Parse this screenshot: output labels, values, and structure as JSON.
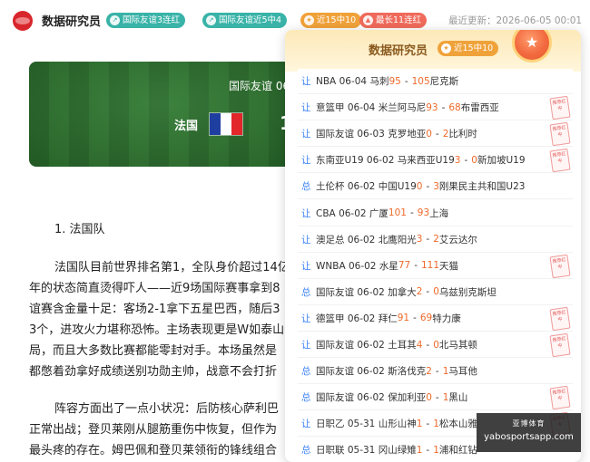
{
  "header": {
    "brand": "数据研究员",
    "pills": [
      {
        "label": "国际友谊3连红",
        "icon": "trend-icon",
        "color": "#39b3a8"
      },
      {
        "label": "国际友谊近5中4",
        "icon": "trend-icon",
        "color": "#39b3a8"
      },
      {
        "label": "近15中10",
        "icon": "star-icon",
        "color": "#f0a23a"
      },
      {
        "label": "最长11连红",
        "icon": "flame-icon",
        "color": "#ef6a5b"
      }
    ],
    "updated": "最近更新：2026-06-05 00:01"
  },
  "banner": {
    "title": "国际友谊 06",
    "team": "法国",
    "score_peek": "1"
  },
  "article": {
    "heading": "1. 法国队",
    "lines": [
      "法国队目前世界排名第1，全队身价超过14亿",
      "年的状态简直烫得吓人——近9场国际赛事拿到8",
      "谊赛含金量十足：客场2-1拿下五星巴西，随后3",
      "3个，进攻火力堪称恐怖。主场表现更是W如泰山",
      "局，而且大多数比赛都能零封对手。本场虽然是",
      "都憋着劲拿好成绩送别功勋主帅，战意不会打折",
      "阵容方面出了一点小状况：后防核心萨利巴",
      "正常出战；登贝莱刚从腿筋重伤中恢复，但作为",
      "最头疼的存在。姆巴佩和登贝莱领衔的锋线组合"
    ]
  },
  "panel": {
    "title": "数据研究员",
    "tag": "近15中10",
    "stamp_text": "推荐红中",
    "rows": [
      {
        "type": "让",
        "league": "NBA",
        "date": "06-04",
        "home": "马刺",
        "s1": "95",
        "s2": "105",
        "away": "尼克斯",
        "stamp": false
      },
      {
        "type": "让",
        "league": "意篮甲",
        "date": "06-04",
        "home": "米兰阿马尼",
        "s1": "93",
        "s2": "68",
        "away": "布雷西亚",
        "stamp": true
      },
      {
        "type": "让",
        "league": "国际友谊",
        "date": "06-03",
        "home": "克罗地亚",
        "s1": "0",
        "s2": "2",
        "away": "比利时",
        "stamp": true
      },
      {
        "type": "让",
        "league": "东南亚U19",
        "date": "06-02",
        "home": "马来西亚U19",
        "s1": "3",
        "s2": "0",
        "away": "新加坡U19",
        "stamp": true
      },
      {
        "type": "总",
        "league": "土伦杯",
        "date": "06-02",
        "home": "中国U19",
        "s1": "0",
        "s2": "3",
        "away": "刚果民主共和国U23",
        "stamp": false
      },
      {
        "type": "让",
        "league": "CBA",
        "date": "06-02",
        "home": "广厦",
        "s1": "101",
        "s2": "93",
        "away": "上海",
        "stamp": false
      },
      {
        "type": "让",
        "league": "澳足总",
        "date": "06-02",
        "home": "北鹰阳光",
        "s1": "3",
        "s2": "2",
        "away": "艾云达尔",
        "stamp": false
      },
      {
        "type": "让",
        "league": "WNBA",
        "date": "06-02",
        "home": "水星",
        "s1": "77",
        "s2": "111",
        "away": "天猫",
        "stamp": true
      },
      {
        "type": "总",
        "league": "国际友谊",
        "date": "06-02",
        "home": "加拿大",
        "s1": "2",
        "s2": "0",
        "away": "乌兹别克斯坦",
        "stamp": false
      },
      {
        "type": "让",
        "league": "德篮甲",
        "date": "06-02",
        "home": "拜仁",
        "s1": "91",
        "s2": "69",
        "away": "特力康",
        "stamp": true
      },
      {
        "type": "让",
        "league": "国际友谊",
        "date": "06-02",
        "home": "土耳其",
        "s1": "4",
        "s2": "0",
        "away": "北马其顿",
        "stamp": true
      },
      {
        "type": "总",
        "league": "国际友谊",
        "date": "06-02",
        "home": "斯洛伐克",
        "s1": "2",
        "s2": "1",
        "away": "马耳他",
        "stamp": false
      },
      {
        "type": "总",
        "league": "国际友谊",
        "date": "06-02",
        "home": "保加利亚",
        "s1": "0",
        "s2": "1",
        "away": "黑山",
        "stamp": true
      },
      {
        "type": "让",
        "league": "日职乙",
        "date": "05-31",
        "home": "山形山神",
        "s1": "1",
        "s2": "1",
        "away": "松本山雅",
        "stamp": true
      },
      {
        "type": "总",
        "league": "日职联",
        "date": "05-31",
        "home": "冈山绿雉",
        "s1": "1",
        "s2": "1",
        "away": "浦和红钻",
        "stamp": false
      }
    ]
  },
  "watermark": {
    "line1": "亚博体育",
    "line2": "yabosportsapp.com"
  }
}
